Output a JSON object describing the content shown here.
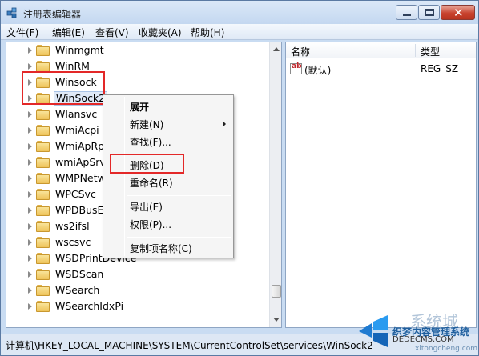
{
  "window": {
    "title": "注册表编辑器",
    "icon": "registry-editor-icon"
  },
  "menu": [
    "文件(F)",
    "编辑(E)",
    "查看(V)",
    "收藏夹(A)",
    "帮助(H)"
  ],
  "tree": {
    "items": [
      {
        "label": "Winmgmt"
      },
      {
        "label": "WinRM"
      },
      {
        "label": "Winsock"
      },
      {
        "label": "WinSock2"
      },
      {
        "label": "Wlansvc"
      },
      {
        "label": "WmiAcpi"
      },
      {
        "label": "WmiApRp"
      },
      {
        "label": "wmiApSrv"
      },
      {
        "label": "WMPNetw"
      },
      {
        "label": "WPCSvc"
      },
      {
        "label": "WPDBusEr"
      },
      {
        "label": "ws2ifsl"
      },
      {
        "label": "wscsvc"
      },
      {
        "label": "WSDPrintDevice"
      },
      {
        "label": "WSDScan"
      },
      {
        "label": "WSearch"
      },
      {
        "label": "WSearchIdxPi"
      }
    ],
    "selected": "WinSock2"
  },
  "list": {
    "headers": {
      "name": "名称",
      "type": "类型"
    },
    "rows": [
      {
        "name": "(默认)",
        "type": "REG_SZ"
      }
    ]
  },
  "context_menu": {
    "items": [
      "展开",
      "新建(N)",
      "查找(F)...",
      "删除(D)",
      "重命名(R)",
      "导出(E)",
      "权限(P)...",
      "复制项名称(C)"
    ]
  },
  "status": {
    "path": "计算机\\HKEY_LOCAL_MACHINE\\SYSTEM\\CurrentControlSet\\services\\WinSock2"
  },
  "watermark": {
    "text1": "织梦内容管理系统",
    "text2": "DEDECMS.COM",
    "text3": "xitongcheng.com",
    "big": "系统城"
  },
  "colors": {
    "highlight_box": "#e32828",
    "titlebar": "#c9dcf2"
  }
}
